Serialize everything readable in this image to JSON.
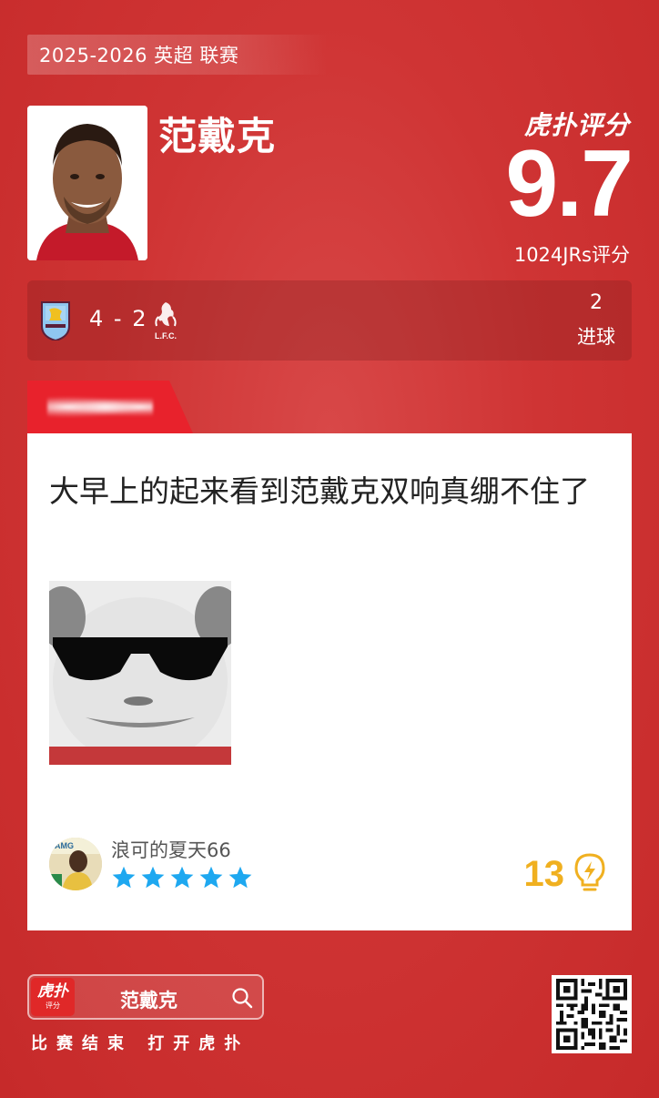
{
  "header": {
    "league": "2025-2026 英超 联赛",
    "brand": "虎扑评分",
    "score": "9.7",
    "rating_count": "1024JRs评分"
  },
  "player": {
    "name": "范戴克"
  },
  "match": {
    "score": "4 - 2",
    "stat_value": "2",
    "stat_label": "进球"
  },
  "comment": {
    "text": "大早上的起来看到范戴克双响真绷不住了",
    "username": "浪可的夏天66",
    "stars": 5,
    "likes": "13"
  },
  "footer": {
    "app_logo_main": "虎扑",
    "app_logo_sub": "评分",
    "search_query": "范戴克",
    "caption": "比赛结束 打开虎扑"
  },
  "colors": {
    "background": "#cf3434",
    "tag_red": "#e8222c",
    "star_blue": "#1ea8f0",
    "like_gold": "#f0b020"
  },
  "icons": [
    "search-icon",
    "lightbulb-icon",
    "star-icon",
    "team-crest-icon",
    "qr-code"
  ]
}
